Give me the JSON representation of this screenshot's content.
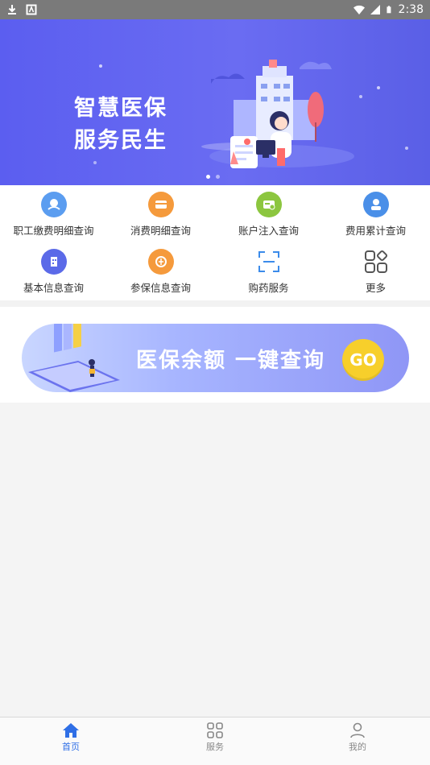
{
  "status_bar": {
    "time": "2:38",
    "icons": [
      "download-icon",
      "notification-icon",
      "wifi-icon",
      "signal-icon",
      "battery-icon"
    ]
  },
  "banner": {
    "line1": "智慧医保",
    "line2": "服务民生",
    "active_slide": 1,
    "slide_count": 2
  },
  "menu": {
    "items": [
      {
        "label": "职工缴费明细查询",
        "icon": "payment-icon",
        "color": "#5b9df0"
      },
      {
        "label": "消费明细查询",
        "icon": "card-icon",
        "color": "#f59a3c"
      },
      {
        "label": "账户注入查询",
        "icon": "account-icon",
        "color": "#8cc63f"
      },
      {
        "label": "费用累计查询",
        "icon": "cost-icon",
        "color": "#4a8fe8"
      },
      {
        "label": "基本信息查询",
        "icon": "building-icon",
        "color": "#5b6ae8"
      },
      {
        "label": "参保信息查询",
        "icon": "insurance-icon",
        "color": "#f59a3c"
      },
      {
        "label": "购药服务",
        "icon": "scan-icon",
        "color": "#3b8bea"
      },
      {
        "label": "更多",
        "icon": "more-grid-icon",
        "color": "#555555"
      }
    ]
  },
  "promo": {
    "text": "医保余额 一键查询",
    "button": "GO"
  },
  "tabbar": {
    "tabs": [
      {
        "label": "首页",
        "icon": "home-icon",
        "active": true
      },
      {
        "label": "服务",
        "icon": "grid-icon",
        "active": false
      },
      {
        "label": "我的",
        "icon": "user-icon",
        "active": false
      }
    ]
  },
  "colors": {
    "banner": "#5b5ef0",
    "accent": "#2f6fe6",
    "go": "#f7cf2b"
  }
}
